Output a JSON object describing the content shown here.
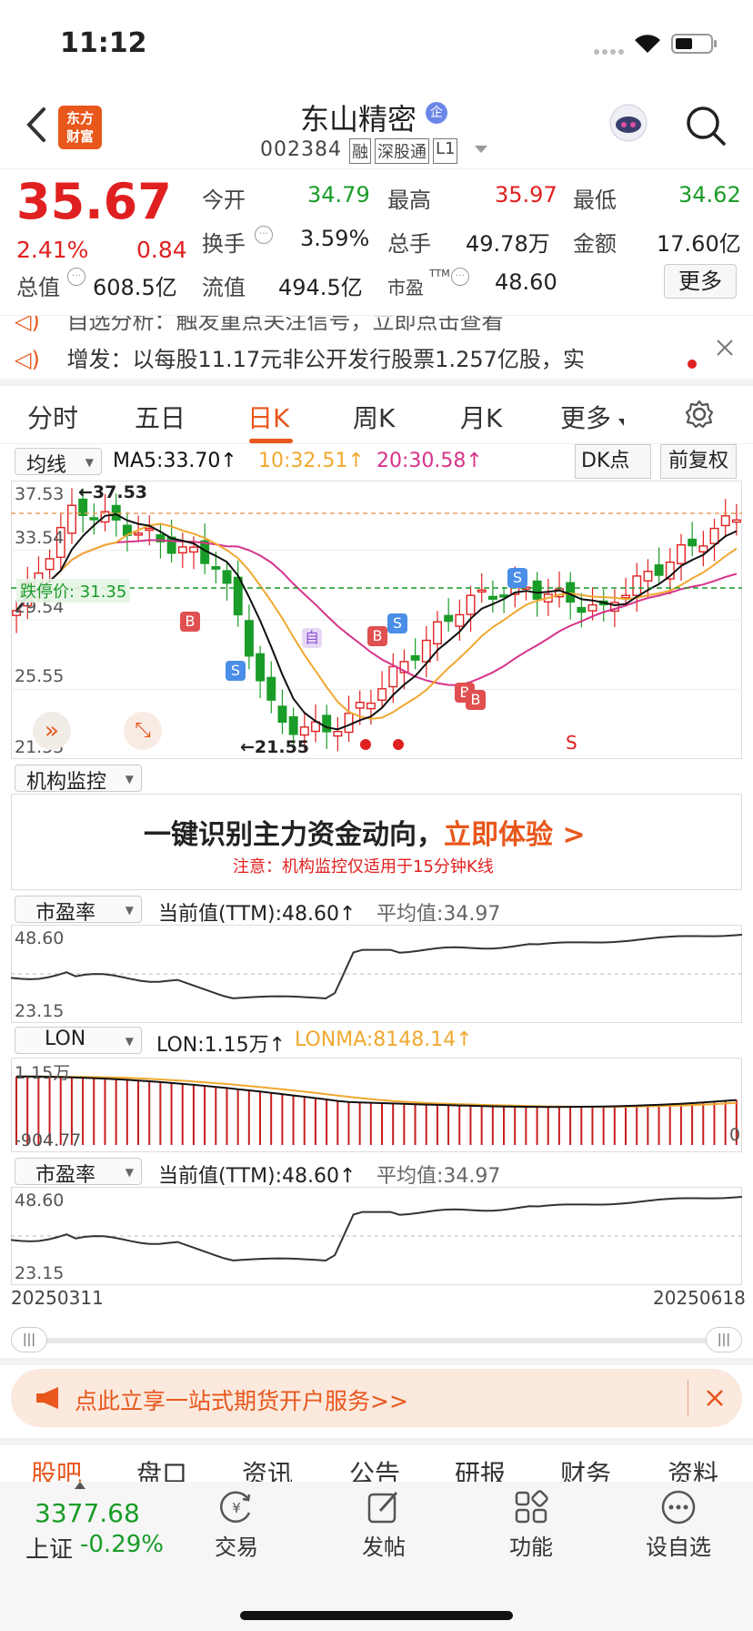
{
  "status_bar": {
    "time": "11:12"
  },
  "header": {
    "logo_text": "东方\n财富",
    "title": "东山精密",
    "title_badge": "企",
    "code": "002384",
    "tags": [
      "融",
      "深股通",
      "L1"
    ]
  },
  "quote": {
    "price": "35.67",
    "change_pct": "2.41%",
    "change": "0.84",
    "fields": [
      {
        "label": "今开",
        "value": "34.79",
        "color": "green"
      },
      {
        "label": "最高",
        "value": "35.97",
        "color": "red"
      },
      {
        "label": "最低",
        "value": "34.62",
        "color": "green"
      },
      {
        "label": "换手",
        "value": "3.59%",
        "color": "black"
      },
      {
        "label": "总手",
        "value": "49.78万",
        "color": "black"
      },
      {
        "label": "金额",
        "value": "17.60亿",
        "color": "black"
      },
      {
        "label": "总值",
        "value": "608.5亿",
        "color": "black"
      },
      {
        "label": "流值",
        "value": "494.5亿",
        "color": "black"
      },
      {
        "label": "市盈",
        "value": "48.60",
        "color": "black"
      }
    ],
    "more_button": "更多",
    "ttm_sup": "TTM"
  },
  "notices": [
    "自选分析：触发重点关注信号，立即点击查看",
    "增发：以每股11.17元非公开发行股票1.257亿股，实"
  ],
  "period_tabs": [
    "分时",
    "五日",
    "日K",
    "周K",
    "月K",
    "更多"
  ],
  "active_tab": "日K",
  "kline": {
    "indicator_select": "均线",
    "ma5": "MA5:33.70↑",
    "ma10": "10:32.51↑",
    "ma20": "20:30.58↑",
    "dk_button": "DK点",
    "adjust_button": "前复权",
    "y_labels": [
      "37.53",
      "33.54",
      "29.54",
      "25.55",
      "21.55"
    ],
    "max_label": "←37.53",
    "min_label": "←21.55",
    "limit_label": "跌停价: 31.35",
    "colors": {
      "up": "#e02020",
      "down": "#1a9c28",
      "ma5": "#111111",
      "ma10": "#f0a830",
      "ma20": "#d6338a"
    }
  },
  "inst_monitor": {
    "select": "机构监控",
    "promo": "一键识别主力资金动向，",
    "promo_link": "立即体验 >",
    "note": "注意：机构监控仅适用于15分钟K线"
  },
  "pe_panel_1": {
    "select": "市盈率",
    "current": "当前值(TTM):48.60↑",
    "avg": "平均值:34.97",
    "y_max": "48.60",
    "y_min": "23.15"
  },
  "lon_panel": {
    "select": "LON",
    "lon": "LON:1.15万↑",
    "lonma": "LONMA:8148.14↑",
    "y_max": "1.15万",
    "y_min": "-904.77",
    "y_zero": "0"
  },
  "pe_panel_2": {
    "select": "市盈率",
    "current": "当前值(TTM):48.60↑",
    "avg": "平均值:34.97",
    "y_max": "48.60",
    "y_min": "23.15"
  },
  "date_axis": {
    "start": "20250311",
    "end": "20250618"
  },
  "promo_banner": {
    "text": "点此立享一站式期货开户服务>>"
  },
  "bottom_tabs": [
    "股吧",
    "盘口",
    "资讯",
    "公告",
    "研报",
    "财务",
    "资料"
  ],
  "bottom_nav": {
    "index_value": "3377.68",
    "index_name": "上证",
    "index_change": "-0.29%",
    "items": [
      "交易",
      "发帖",
      "功能",
      "设自选"
    ]
  }
}
